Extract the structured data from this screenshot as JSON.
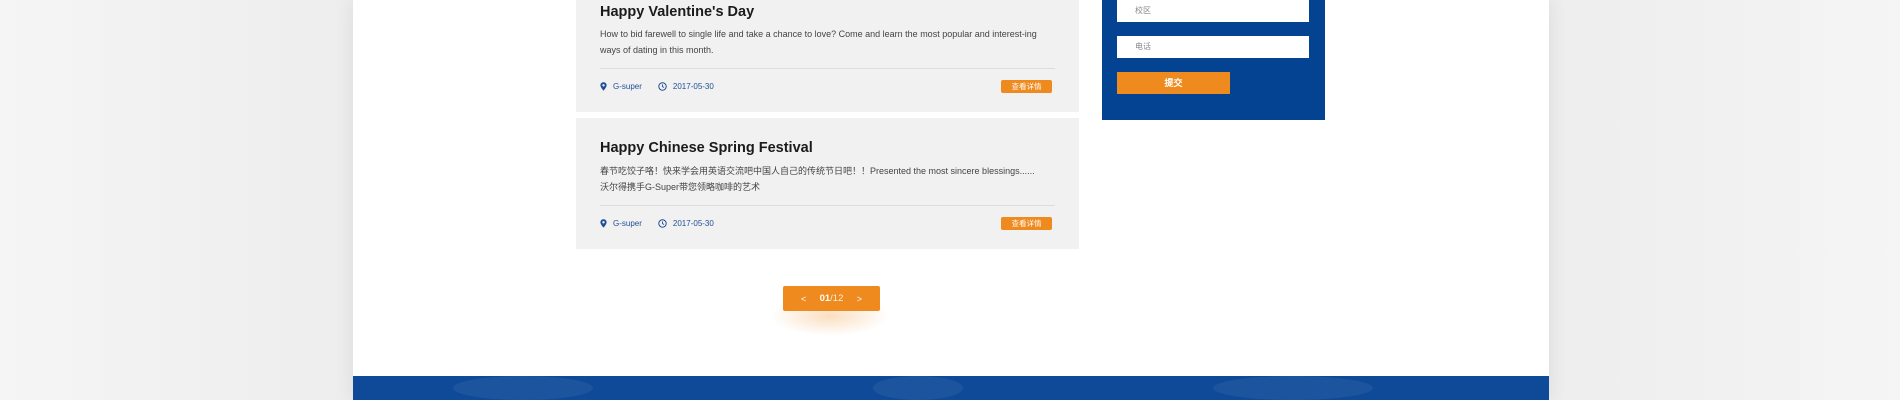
{
  "articles": [
    {
      "title": "Happy Valentine's Day",
      "description": "How to bid farewell to single life and take a chance to love? Come and learn the most popular and interest-ing ways of dating in this month.",
      "author": "G-super",
      "date": "2017-05-30",
      "detail_label": "查看详情"
    },
    {
      "title": "Happy Chinese Spring Festival",
      "description_line1": "春节吃饺子咯！快来学会用英语交流吧中国人自己的传统节日吧！！Presented the most sincere blessings......",
      "description_line2": "沃尔得携手G-Super带您领略咖啡的艺术",
      "author": "G-super",
      "date": "2017-05-30",
      "detail_label": "查看详情"
    }
  ],
  "pagination": {
    "prev": "<",
    "current": "01",
    "total": "/12",
    "next": ">"
  },
  "form": {
    "campus_placeholder": "校区",
    "phone_placeholder": "电话",
    "submit_label": "提交"
  },
  "colors": {
    "accent_orange": "#ee8a1e",
    "brand_blue": "#034392",
    "meta_blue": "#1f4f97"
  },
  "icons": {
    "location": "location-pin-icon",
    "time": "clock-icon"
  }
}
